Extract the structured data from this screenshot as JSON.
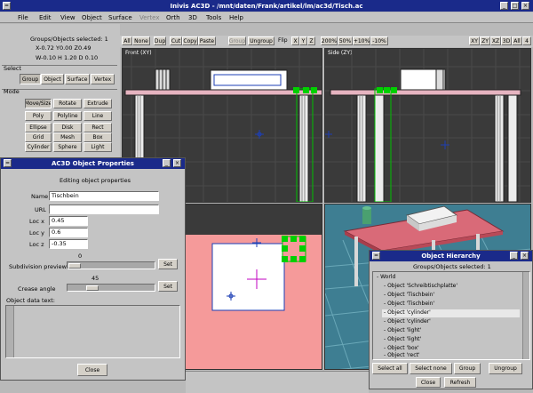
{
  "window": {
    "title": "Inivis AC3D - /mnt/daten/Frank/artikel/lm/ac3d/Tisch.ac",
    "icon_label": "AC3D"
  },
  "menu": [
    "File",
    "Edit",
    "View",
    "Object",
    "Surface",
    "Vertex",
    "Orth",
    "3D",
    "Tools",
    "Help"
  ],
  "info": {
    "selected": "Groups/Objects selected: 1",
    "xyz": "X-0.72 Y0.00 Z0.49",
    "whd": "W-0.10 H 1.20 D 0.10"
  },
  "select": {
    "title": "Select",
    "buttons": [
      "Group",
      "Object",
      "Surface",
      "Vertex"
    ]
  },
  "mode": {
    "title": "Mode",
    "buttons": [
      "Move/Size",
      "Rotate",
      "Extrude",
      "Poly",
      "Polyline",
      "Line",
      "Ellipse",
      "Disk",
      "Rect",
      "Grid",
      "Mesh",
      "Box",
      "Cylinder",
      "Sphere",
      "Light"
    ]
  },
  "toolbar": {
    "buttons": [
      "All",
      "None",
      "Dup",
      "Cut",
      "Copy",
      "Paste",
      "Group",
      "Ungroup",
      "Flip",
      "X",
      "Y",
      "Z",
      "200%",
      "50%",
      "+10%",
      "-10%"
    ],
    "view_buttons": [
      "XY",
      "ZY",
      "XZ",
      "3D",
      "All",
      "4"
    ]
  },
  "viewports": {
    "front": "Front (XY)",
    "side": "Side (ZY)"
  },
  "props_dialog": {
    "title": "AC3D Object Properties",
    "subtitle": "Editing object properties",
    "name_label": "Name",
    "name_value": "Tischbein",
    "url_label": "URL",
    "url_value": "",
    "locx_label": "Loc x",
    "locx_value": "0.45",
    "locy_label": "Loc y",
    "locy_value": "0.6",
    "locz_label": "Loc z",
    "locz_value": "-0.35",
    "subdiv_value": "0",
    "subdiv_label": "Subdivision preview",
    "set1": "Set",
    "crease_value": "45",
    "crease_label": "Crease angle",
    "set2": "Set",
    "data_label": "Object data text:",
    "close": "Close"
  },
  "hierarchy": {
    "title": "Object Hierarchy",
    "selected": "Groups/Objects selected: 1",
    "items": [
      "- World",
      "- Object 'Schreibtischplatte'",
      "- Object 'Tischbein'",
      "- Object 'Tischbein'",
      "- Object 'cylinder'",
      "- Object 'cylinder'",
      "- Object 'light'",
      "- Object 'light'",
      "- Object 'box'",
      "- Object 'rect'"
    ],
    "highlighted_index": 4,
    "buttons": [
      "Select all",
      "Select none",
      "Group",
      "Ungroup"
    ],
    "close": "Close",
    "refresh": "Refresh"
  },
  "colors": {
    "title_active": "#1a2a8a",
    "table_top": "#e6b4c0",
    "table_3d": "#d96a78",
    "viewport_bg": "#3c3c3c",
    "selection_handle": "#00d000"
  }
}
